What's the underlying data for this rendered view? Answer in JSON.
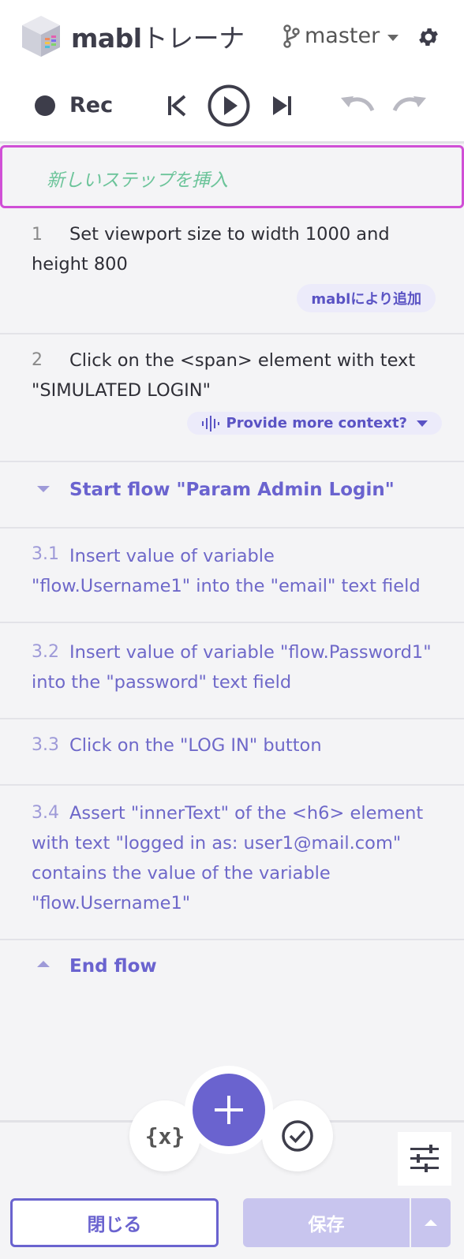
{
  "header": {
    "app_name_bold": "mabl",
    "app_name_rest": "トレーナ",
    "branch_label": "master",
    "logo_icon": "mabl-cube-logo",
    "branch_icon": "git-branch-icon",
    "settings_icon": "gear-icon"
  },
  "controls": {
    "rec_label": "Rec",
    "icons": [
      "record-dot-icon",
      "skip-to-start-icon",
      "play-icon",
      "step-forward-icon",
      "undo-icon",
      "redo-icon"
    ]
  },
  "insert_step": {
    "placeholder": "新しいステップを挿入"
  },
  "steps": [
    {
      "number": "1",
      "text": "Set viewport size to width 1000 and height 800",
      "badge": "mablにより追加"
    },
    {
      "number": "2",
      "text": "Click on the <span> element with text \"SIMULATED LOGIN\"",
      "context_button": "Provide more context?"
    }
  ],
  "flow": {
    "start_label": "Start flow \"Param Admin Login\"",
    "end_label": "End flow",
    "sub_steps": [
      {
        "number": "3.1",
        "text": "Insert value of variable \"flow.Username1\" into the \"email\" text field"
      },
      {
        "number": "3.2",
        "text": "Insert value of variable \"flow.Password1\" into the \"password\" text field"
      },
      {
        "number": "3.3",
        "text": "Click on the \"LOG IN\" button"
      },
      {
        "number": "3.4",
        "text": "Assert \"innerText\" of the <h6> element with text \"logged in as: user1@mail.com\" contains the value of the variable \"flow.Username1\""
      }
    ]
  },
  "bottom": {
    "variable_button_label": "{x}",
    "close_label": "閉じる",
    "save_label": "保存",
    "icons": [
      "add-icon",
      "check-circle-icon",
      "adjust-sliders-icon"
    ]
  },
  "colors": {
    "accent": "#6a63cf",
    "insert_border": "#d04fd6",
    "placeholder": "#6cc49a",
    "list_bg": "#f4f4f6"
  }
}
